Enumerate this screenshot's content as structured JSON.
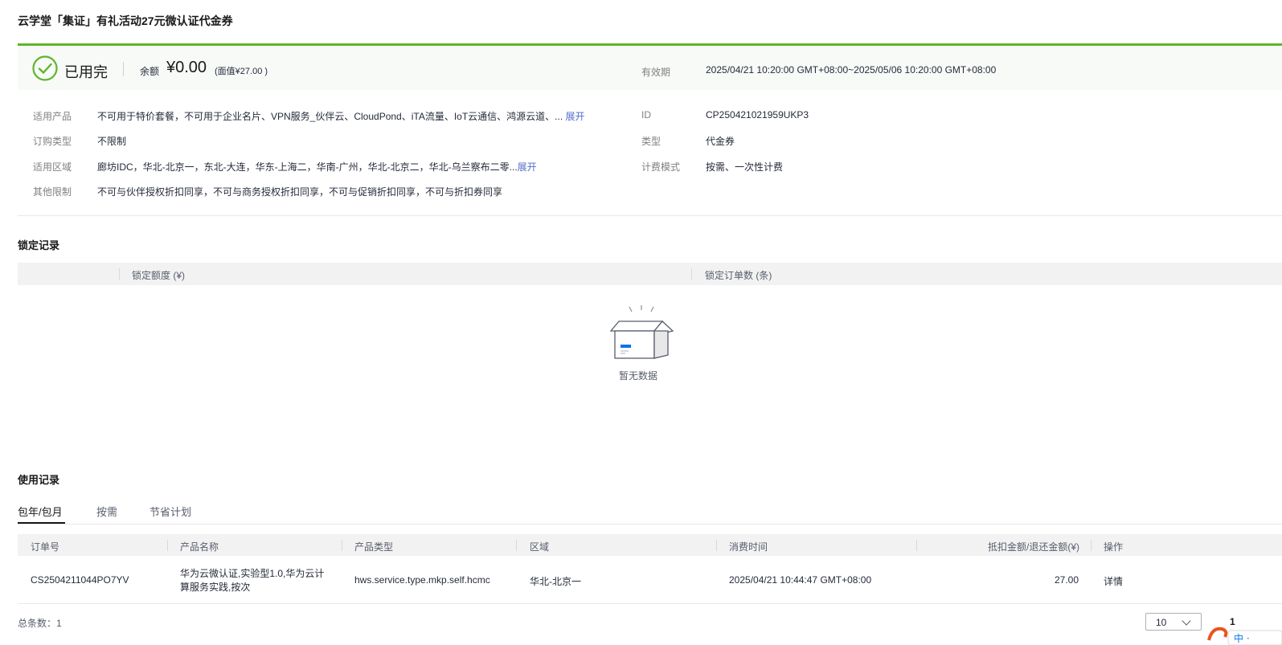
{
  "title": "云学堂「集证」有礼活动27元微认证代金券",
  "status": {
    "text": "已用完",
    "balance_label": "余额",
    "balance_value": "¥0.00",
    "face_value": "(面值¥27.00 )",
    "validity_label": "有效期",
    "validity_value": "2025/04/21 10:20:00 GMT+08:00~2025/05/06 10:20:00 GMT+08:00"
  },
  "details": {
    "applicable_products_label": "适用产品",
    "applicable_products_value": "不可用于特价套餐，不可用于企业名片、VPN服务_伙伴云、CloudPond、iTA流量、IoT云通信、鸿源云道、...",
    "applicable_products_expand": "展开",
    "order_type_label": "订购类型",
    "order_type_value": "不限制",
    "region_label": "适用区域",
    "region_value": "廊坊IDC，华北-北京一，东北-大连，华东-上海二，华南-广州，华北-北京二，华北-乌兰察布二零...",
    "region_expand": "展开",
    "other_label": "其他限制",
    "other_value": "不可与伙伴授权折扣同享，不可与商务授权折扣同享，不可与促销折扣同享，不可与折扣券同享",
    "id_label": "ID",
    "id_value": "CP250421021959UKP3",
    "type_label": "类型",
    "type_value": "代金券",
    "billing_label": "计费模式",
    "billing_value": "按需、一次性计费"
  },
  "lock_records": {
    "title": "锁定记录",
    "columns": [
      "锁定额度 (¥)",
      "锁定订单数 (条)"
    ],
    "empty_text": "暂无数据"
  },
  "usage_records": {
    "title": "使用记录",
    "tabs": [
      "包年/包月",
      "按需",
      "节省计划"
    ],
    "columns": [
      "订单号",
      "产品名称",
      "产品类型",
      "区域",
      "消费时间",
      "抵扣金额/退还金额(¥)",
      "操作"
    ],
    "rows": [
      {
        "order_id": "CS2504211044PO7YV",
        "product_name_line1": "华为云微认证,实验型1.0,华为云计",
        "product_name_line2": "算服务实践,按次",
        "product_type": "hws.service.type.mkp.self.hcmc",
        "region": "华北-北京一",
        "time": "2025/04/21 10:44:47 GMT+08:00",
        "amount": "27.00",
        "action": "详情"
      }
    ],
    "total_label": "总条数：1",
    "page_size": "10",
    "page": "1"
  },
  "colors": {
    "accent_green": "#5eb52b",
    "link_blue": "#526ecc"
  }
}
